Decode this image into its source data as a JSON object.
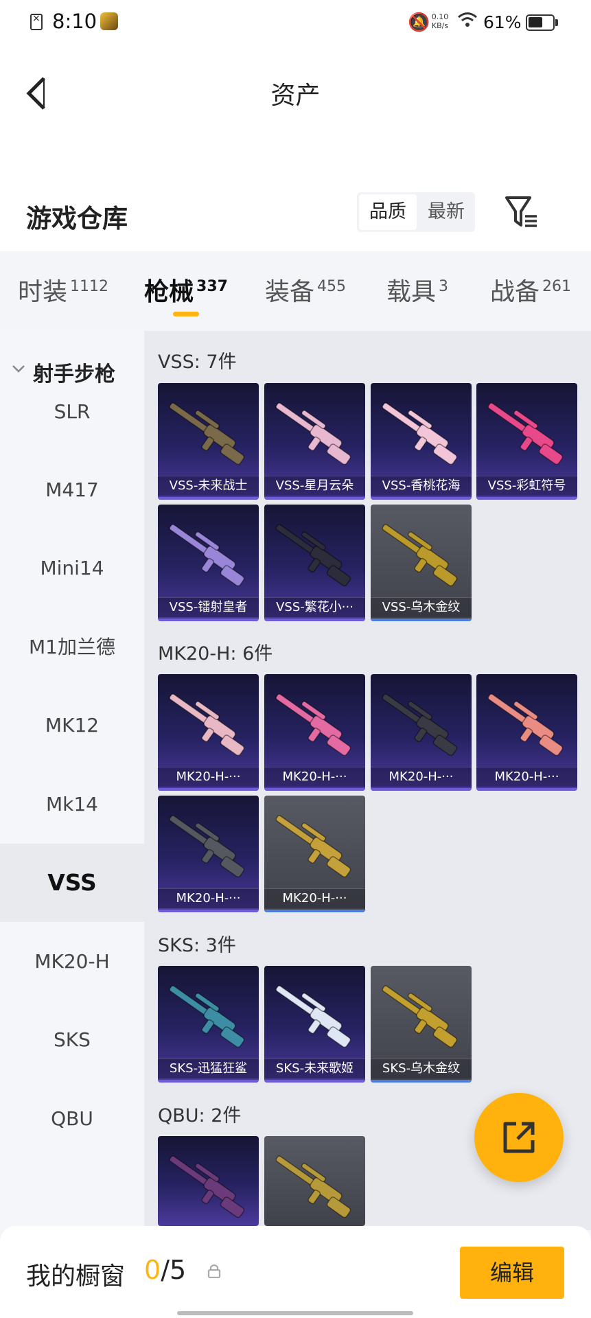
{
  "status_bar": {
    "time": "8:10",
    "speed_value": "0.10",
    "speed_unit": "KB/s",
    "battery_text": "61%",
    "battery_level": 0.61
  },
  "header": {
    "title": "资产",
    "section_title": "游戏仓库",
    "sort_quality": "品质",
    "sort_newest": "最新"
  },
  "tabs": [
    {
      "label": "时装",
      "count": "1112"
    },
    {
      "label": "枪械",
      "count": "337"
    },
    {
      "label": "装备",
      "count": "455"
    },
    {
      "label": "载具",
      "count": "3"
    },
    {
      "label": "战备",
      "count": "261"
    }
  ],
  "sidebar": {
    "header": "射手步枪",
    "items": [
      "SLR",
      "M417",
      "Mini14",
      "M1加兰德",
      "MK12",
      "Mk14",
      "VSS",
      "MK20-H",
      "SKS",
      "QBU"
    ]
  },
  "groups": [
    {
      "title": "VSS: 7件",
      "items": [
        {
          "label": "VSS-未来战士",
          "style": "purple",
          "gun": "#7a6a4a"
        },
        {
          "label": "VSS-星月云朵",
          "style": "purple",
          "gun": "#e8b8d0"
        },
        {
          "label": "VSS-香桃花海",
          "style": "purple",
          "gun": "#f2c6d8"
        },
        {
          "label": "VSS-彩虹符号",
          "style": "purple",
          "gun": "#e7498a"
        },
        {
          "label": "VSS-镭射皇者",
          "style": "purple",
          "gun": "#9a86d8"
        },
        {
          "label": "VSS-繁花小···",
          "style": "purple",
          "gun": "#2c2c3a"
        },
        {
          "label": "VSS-乌木金纹",
          "style": "gray",
          "gun": "#b99a2a"
        }
      ]
    },
    {
      "title": "MK20-H: 6件",
      "items": [
        {
          "label": "MK20-H-···",
          "style": "purple",
          "gun": "#e8b8c4"
        },
        {
          "label": "MK20-H-···",
          "style": "purple",
          "gun": "#e46aa4"
        },
        {
          "label": "MK20-H-···",
          "style": "purple",
          "gun": "#3a3a44"
        },
        {
          "label": "MK20-H-···",
          "style": "purple",
          "gun": "#e98c84"
        },
        {
          "label": "MK20-H-···",
          "style": "purple",
          "gun": "#55585e"
        },
        {
          "label": "MK20-H-···",
          "style": "gray",
          "gun": "#c4a13a"
        }
      ]
    },
    {
      "title": "SKS: 3件",
      "items": [
        {
          "label": "SKS-迅猛狂鲨",
          "style": "purple",
          "gun": "#3d8ea4"
        },
        {
          "label": "SKS-未来歌姬",
          "style": "purple",
          "gun": "#dfe6f4"
        },
        {
          "label": "SKS-乌木金纹",
          "style": "gray",
          "gun": "#c29f2e"
        }
      ]
    },
    {
      "title": "QBU: 2件",
      "items": [
        {
          "label": "",
          "style": "purple",
          "gun": "#6a3a7a"
        },
        {
          "label": "",
          "style": "gray",
          "gun": "#b69a3a"
        }
      ]
    }
  ],
  "bottom": {
    "showcase_label": "我的橱窗",
    "showcase_current": "0",
    "showcase_total": "/5",
    "edit_label": "编辑"
  },
  "colors": {
    "accent": "#ffb20e",
    "card_purple": "#262262",
    "card_gray": "#4a4c55"
  },
  "icons": [
    "back-arrow-icon",
    "filter-icon",
    "share-out-icon",
    "lock-icon",
    "chevron-down-icon",
    "wifi-icon",
    "mute-bell-icon",
    "battery-icon"
  ]
}
